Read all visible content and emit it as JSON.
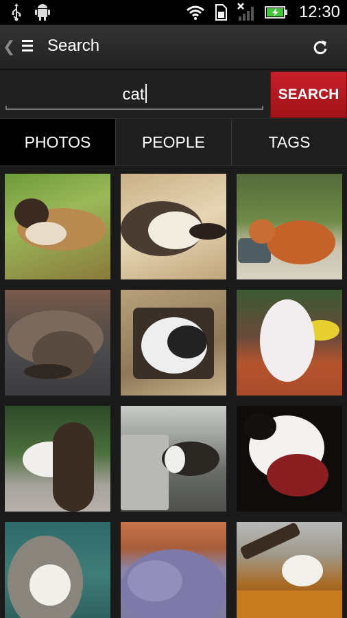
{
  "status_bar": {
    "time": "12:30",
    "left_icons": [
      "usb-icon",
      "android-debug-icon"
    ],
    "right_icons": [
      "wifi-icon",
      "sd-card-icon",
      "no-signal-icon",
      "battery-charging-icon"
    ]
  },
  "action_bar": {
    "title": "Search",
    "back_icon": "chevron-left-icon",
    "menu_icon": "hamburger-menu-icon",
    "refresh_icon": "refresh-icon"
  },
  "search": {
    "query": "cat",
    "button_label": "SEARCH"
  },
  "tabs": [
    {
      "label": "PHOTOS",
      "active": true
    },
    {
      "label": "PEOPLE",
      "active": false
    },
    {
      "label": "TAGS",
      "active": false
    }
  ],
  "colors": {
    "accent": "#c8202a",
    "background": "#1a1a1a",
    "active_tab": "#000000"
  }
}
